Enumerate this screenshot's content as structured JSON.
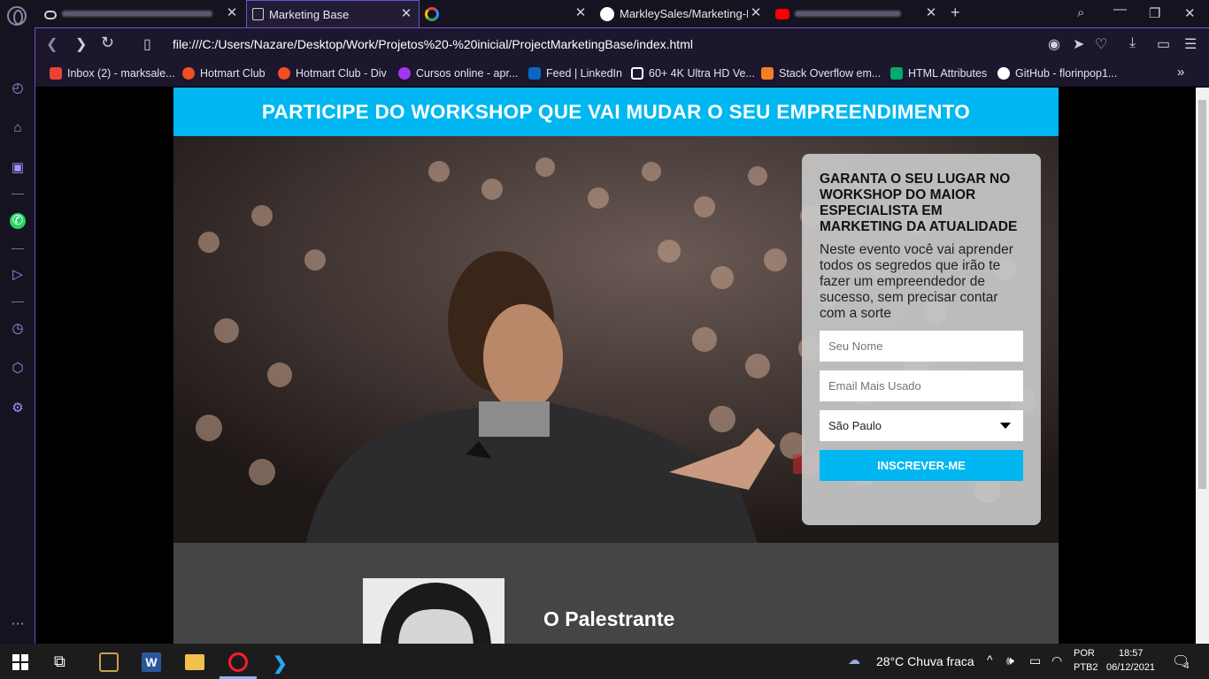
{
  "browser": {
    "tabs": [
      {
        "label": "Marketing Base",
        "active": true
      },
      {
        "label": "MarkleySales/Marketing-Ba",
        "active": false
      }
    ],
    "address": "file:///C:/Users/Nazare/Desktop/Work/Projetos%20-%20inicial/ProjectMarketingBase/index.html",
    "bookmarks": [
      {
        "label": "Inbox (2) - marksale...",
        "icon": "gmail-icon",
        "color": "#ea4335"
      },
      {
        "label": "Hotmart Club",
        "icon": "hotmart-icon",
        "color": "#f04e23"
      },
      {
        "label": "Hotmart Club - Div",
        "icon": "hotmart-icon",
        "color": "#f04e23"
      },
      {
        "label": "Cursos online - apr...",
        "icon": "udemy-icon",
        "color": "#a435f0"
      },
      {
        "label": "Feed | LinkedIn",
        "icon": "linkedin-icon",
        "color": "#0a66c2"
      },
      {
        "label": "60+ 4K Ultra HD Ve...",
        "icon": "unsplash-icon",
        "color": "#ffffff"
      },
      {
        "label": "Stack Overflow em...",
        "icon": "stackoverflow-icon",
        "color": "#f48024"
      },
      {
        "label": "HTML Attributes",
        "icon": "w3schools-icon",
        "color": "#04aa6d"
      },
      {
        "label": "GitHub - florinpop1...",
        "icon": "github-icon",
        "color": "#ffffff"
      }
    ]
  },
  "page": {
    "header": "PARTICIPE DO WORKSHOP QUE VAI MUDAR O SEU EMPREENDIMENTO",
    "form": {
      "title": "GARANTA O SEU LUGAR NO WORKSHOP DO MAIOR ESPECIALISTA EM MARKETING DA ATUALIDADE",
      "text": "Neste evento você vai aprender todos os segredos que irão te fazer um empreendedor de sucesso, sem precisar contar com a sorte",
      "name_placeholder": "Seu Nome",
      "email_placeholder": "Email Mais Usado",
      "city": "São Paulo",
      "button": "INSCREVER-ME"
    },
    "speaker_title": "O Palestrante"
  },
  "taskbar": {
    "weather": "28°C  Chuva fraca",
    "lang1": "POR",
    "lang2": "PTB2",
    "time": "18:57",
    "date": "06/12/2021",
    "notifications": "4"
  },
  "colors": {
    "accent": "#00b7f1",
    "opera": "#6e4fd3"
  }
}
